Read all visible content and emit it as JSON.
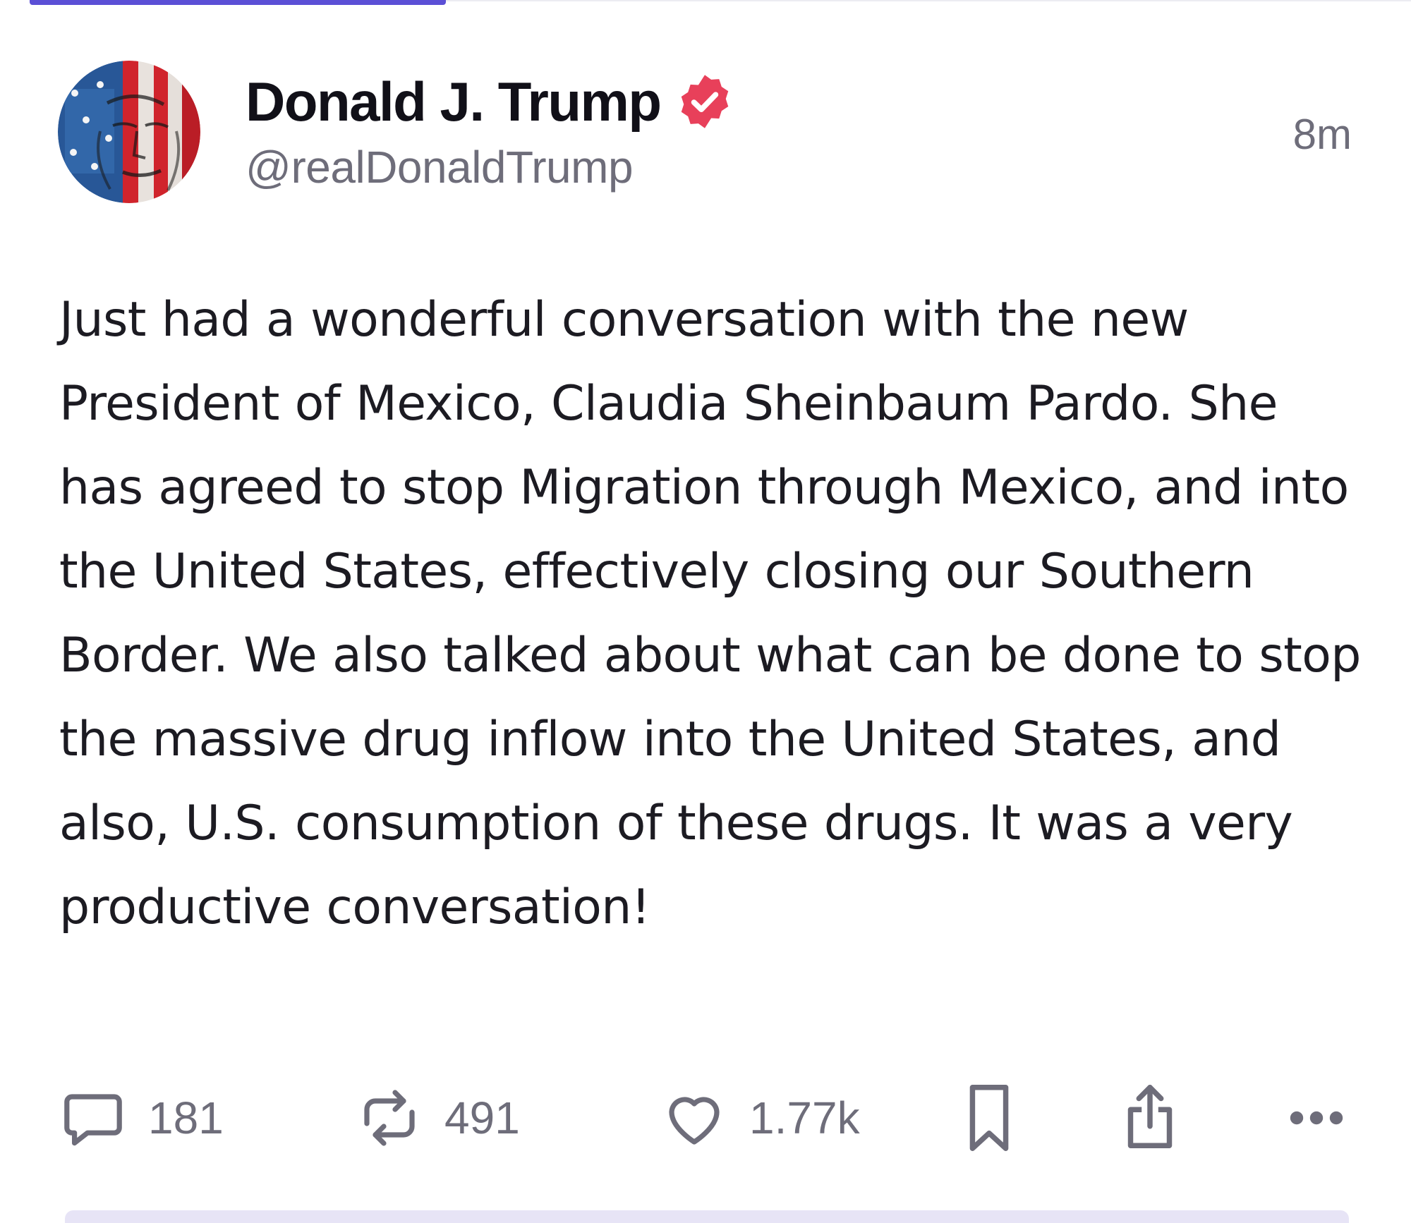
{
  "post": {
    "author_name": "Donald J. Trump",
    "author_handle": "@realDonaldTrump",
    "timestamp": "8m",
    "verified_icon": "verified-badge-icon",
    "body": "Just had a wonderful conversation with the new President of Mexico, Claudia Sheinbaum Pardo. She has agreed to stop Migration through Mexico, and into the United States, effectively closing our Southern Border. We also talked about what can be done to stop the massive drug inflow into the United States, and also, U.S. consumption of these drugs. It was a very productive conversation!"
  },
  "actions": {
    "reply_count": "181",
    "retruth_count": "491",
    "like_count": "1.77k",
    "icons": [
      "reply-icon",
      "retruth-icon",
      "like-icon",
      "bookmark-icon",
      "share-icon",
      "more-icon"
    ]
  },
  "colors": {
    "accent": "#5b4fd6",
    "verified": "#e8405a",
    "muted_text": "#6e6d7a",
    "text": "#1c1b22"
  }
}
